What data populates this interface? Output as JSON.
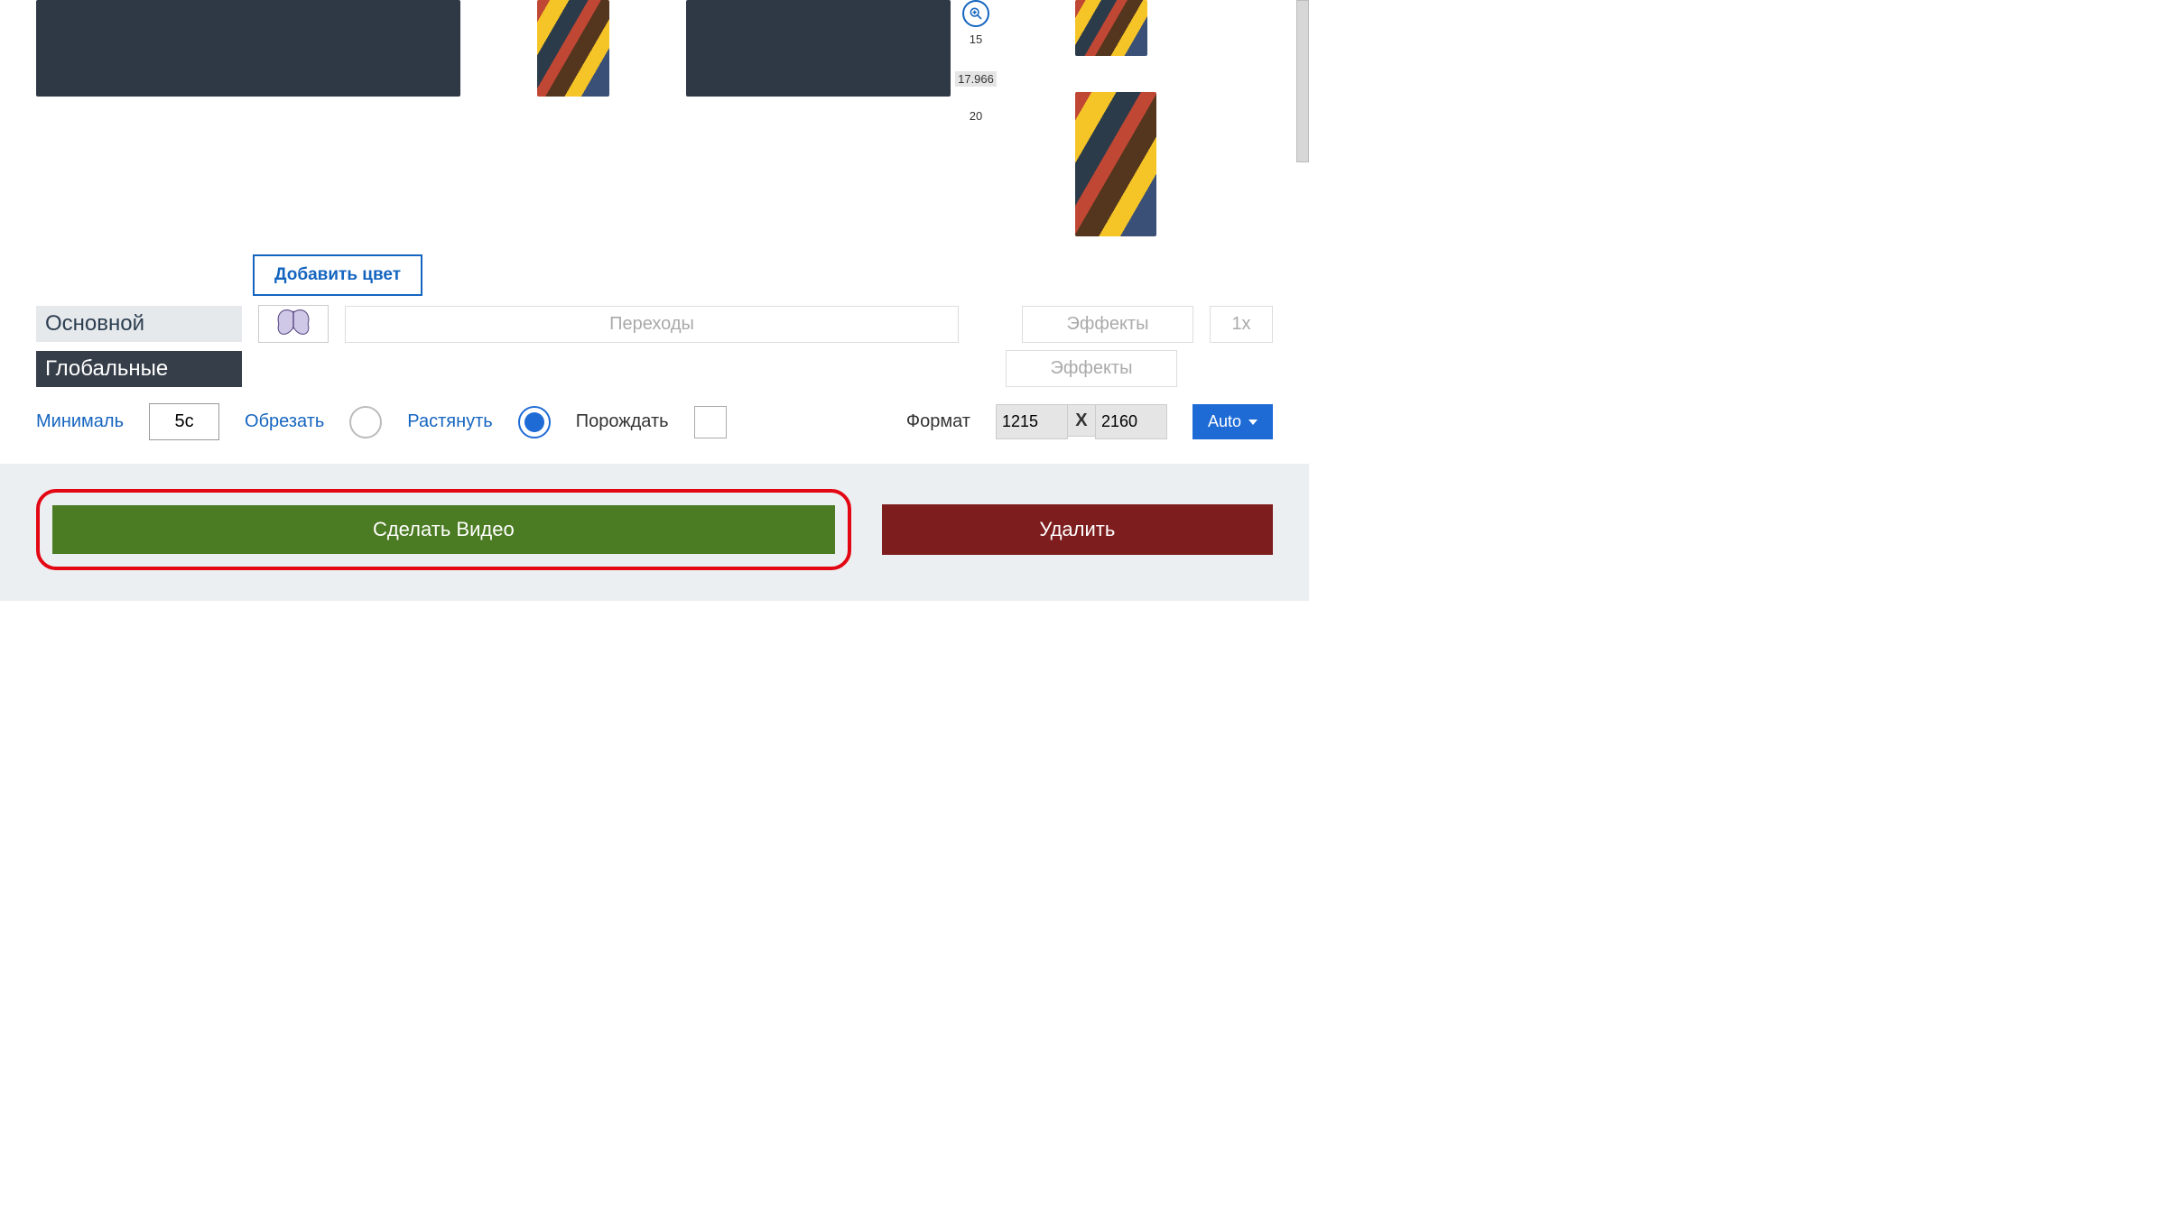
{
  "zoom": {
    "v15": "15",
    "boxed": "17.966",
    "v20": "20"
  },
  "buttons": {
    "add_color": "Добавить цвет",
    "make_video": "Сделать Видео",
    "delete": "Удалить",
    "auto": "Auto"
  },
  "tabs": {
    "main": "Основной",
    "global": "Глобальные"
  },
  "ghost": {
    "transitions": "Переходы",
    "effects": "Эффекты",
    "speed": "1x"
  },
  "opts": {
    "minimal": "Минималь",
    "duration": "5с",
    "crop": "Обрезать",
    "stretch": "Растянуть",
    "spawn": "Порождать",
    "format": "Формат",
    "w": "1215",
    "x": "X",
    "h": "2160"
  }
}
